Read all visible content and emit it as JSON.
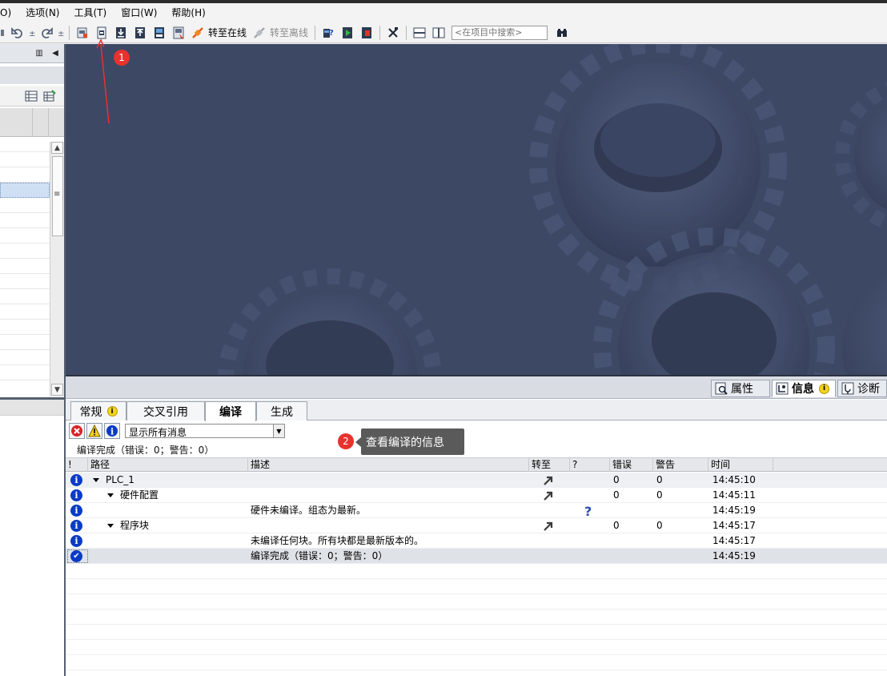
{
  "menu": [
    "O)",
    "选项(N)",
    "工具(T)",
    "窗口(W)",
    "帮助(H)"
  ],
  "toolbar": {
    "go_online": "转至在线",
    "go_offline": "转至离线",
    "search_placeholder": "<在项目中搜索>"
  },
  "inspector_tabs": {
    "properties": "属性",
    "info": "信息",
    "diagnostics": "诊断"
  },
  "subtabs": [
    "常规",
    "交叉引用",
    "编译",
    "生成"
  ],
  "filter": {
    "selected": "显示所有消息"
  },
  "summary": "编译完成（错误：0；警告：0）",
  "table": {
    "headers": [
      "!",
      "路径",
      "描述",
      "转至",
      "?",
      "错误",
      "警告",
      "时间"
    ],
    "rows": [
      {
        "path": "PLC_1",
        "desc": "",
        "errors": "0",
        "warnings": "0",
        "time": "14:45:10"
      },
      {
        "path": "硬件配置",
        "desc": "",
        "errors": "0",
        "warnings": "0",
        "time": "14:45:11"
      },
      {
        "path": "",
        "desc": "硬件未编译。组态为最新。",
        "errors": "",
        "warnings": "",
        "time": "14:45:19"
      },
      {
        "path": "程序块",
        "desc": "",
        "errors": "0",
        "warnings": "0",
        "time": "14:45:17"
      },
      {
        "path": "",
        "desc": "未编译任何块。所有块都是最新版本的。",
        "errors": "",
        "warnings": "",
        "time": "14:45:17"
      },
      {
        "path": "",
        "desc": "编译完成（错误：0；警告：0）",
        "errors": "",
        "warnings": "",
        "time": "14:45:19"
      }
    ]
  },
  "annotations": {
    "marker1": "1",
    "marker2": "2",
    "tooltip": "查看编译的信息"
  },
  "colors": {
    "accent": "#0a3bc5",
    "marker": "#e8322e",
    "canvas": "#3d4864"
  }
}
